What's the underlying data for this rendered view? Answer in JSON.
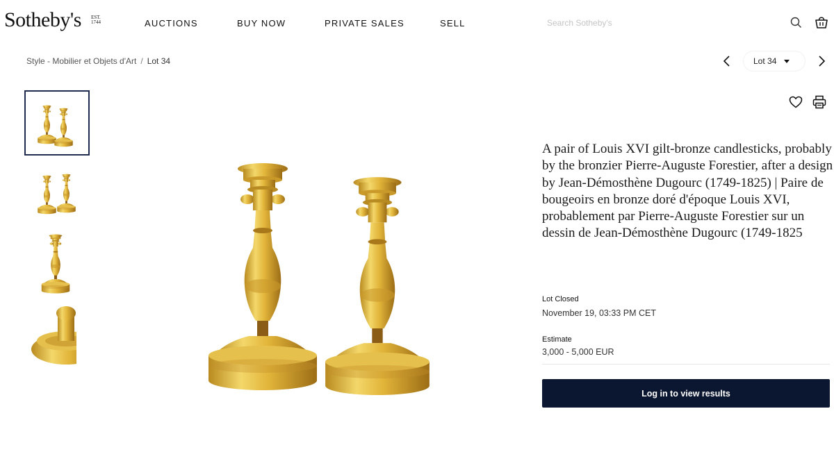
{
  "brand": {
    "name": "Sotheby's",
    "est_line1": "EST.",
    "est_line2": "1744"
  },
  "nav": {
    "items": [
      "AUCTIONS",
      "BUY NOW",
      "PRIVATE SALES",
      "SELL"
    ]
  },
  "search": {
    "placeholder": "Search Sotheby's",
    "value": ""
  },
  "icons": {
    "search": "search-icon",
    "bag": "shopping-bag-icon",
    "prev": "chevron-left-icon",
    "next": "chevron-right-icon",
    "caret": "caret-down-icon",
    "favorite": "heart-icon",
    "print": "printer-icon"
  },
  "breadcrumb": {
    "parent": "Style - Mobilier et Objets d'Art",
    "separator": "/",
    "current": "Lot 34"
  },
  "lot_selector": {
    "value": "Lot 34"
  },
  "lot": {
    "title": "A pair of Louis XVI gilt-bronze candlesticks, probably by the bronzier Pierre-Auguste Forestier, after a design by Jean-Démosthène Dugourc (1749-1825) | Paire de bougeoirs en bronze doré d'époque Louis XVI, probablement par Pierre-Auguste Forestier sur un dessin de Jean-Démosthène Dugourc (1749-1825",
    "status_label": "Lot Closed",
    "closed_date": "November 19, 03:33 PM CET",
    "estimate_label": "Estimate",
    "estimate_value": "3,000 - 5,000 EUR",
    "login_button": "Log in to view results"
  },
  "thumbnails": [
    {
      "name": "pair-front",
      "active": true
    },
    {
      "name": "pair-alternate",
      "active": false
    },
    {
      "name": "candlestick-detail",
      "active": false
    },
    {
      "name": "base-detail",
      "active": false
    }
  ],
  "colors": {
    "accent": "#0b1631",
    "thumb_border": "#1e2b4f",
    "gold_light": "#f2d463",
    "gold": "#d9ac2c",
    "gold_dark": "#a9791a"
  }
}
